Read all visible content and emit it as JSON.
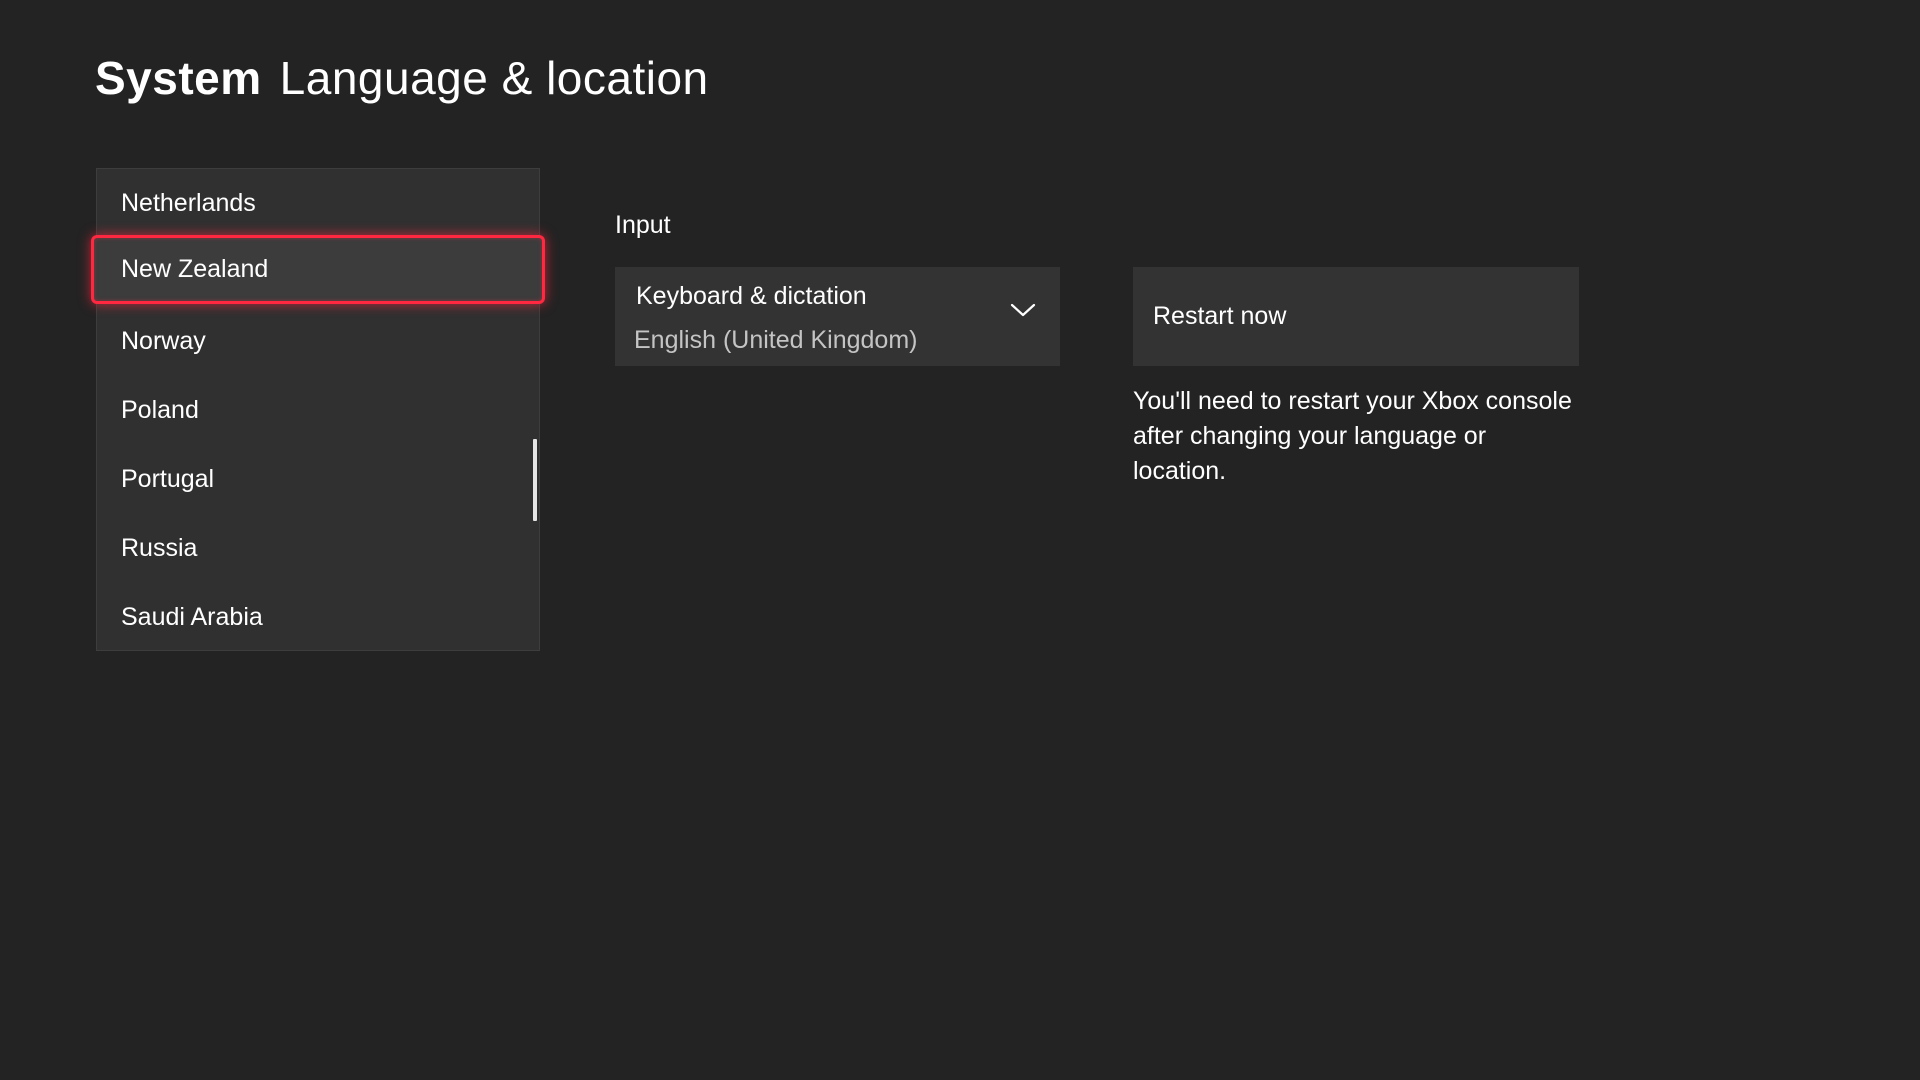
{
  "header": {
    "section": "System",
    "title": "Language & location"
  },
  "countries": {
    "items": [
      "Netherlands",
      "New Zealand",
      "Norway",
      "Poland",
      "Portugal",
      "Russia",
      "Saudi Arabia"
    ],
    "selected": "New Zealand",
    "focus_color": "#ff2840"
  },
  "input": {
    "label": "Input",
    "dropdown": {
      "title": "Keyboard & dictation",
      "value": "English (United Kingdom)",
      "icon": "chevron-down-icon"
    }
  },
  "restart": {
    "button_label": "Restart now",
    "note": "You'll need to restart your Xbox console after changing your language or location."
  }
}
